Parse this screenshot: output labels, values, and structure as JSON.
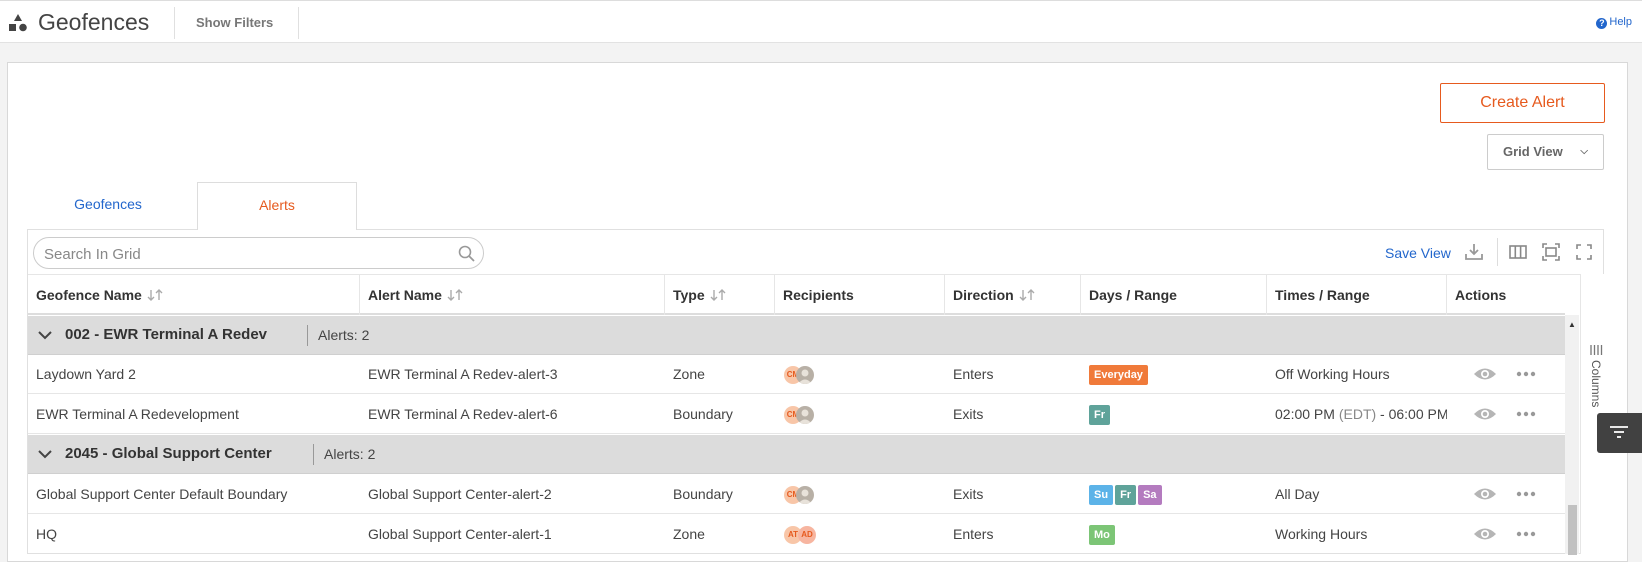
{
  "header": {
    "title": "Geofences",
    "show_filters": "Show Filters",
    "help": "Help"
  },
  "actions": {
    "create_alert": "Create Alert",
    "grid_view": "Grid View"
  },
  "tabs": [
    {
      "label": "Geofences",
      "active": false
    },
    {
      "label": "Alerts",
      "active": true
    }
  ],
  "toolbar": {
    "search_placeholder": "Search In Grid",
    "save_view": "Save View"
  },
  "columns": {
    "geofence_name": "Geofence Name",
    "alert_name": "Alert Name",
    "type": "Type",
    "recipients": "Recipients",
    "direction": "Direction",
    "days_range": "Days / Range",
    "times_range": "Times / Range",
    "actions": "Actions"
  },
  "side_panel": {
    "columns_label": "Columns"
  },
  "groups": [
    {
      "name": "002 - EWR Terminal A Redev",
      "count": "Alerts: 2",
      "rows": [
        {
          "geofence": "Laydown Yard 2",
          "alert": "EWR Terminal A Redev-alert-3",
          "type": "Zone",
          "recipients": [
            "CM",
            "photo"
          ],
          "direction": "Enters",
          "days": [
            {
              "label": "Everyday",
              "color": "#f07a3a"
            }
          ],
          "time_main": "Off Working Hours",
          "time_tz": "",
          "time_end": ""
        },
        {
          "geofence": "EWR Terminal A Redevelopment",
          "alert": "EWR Terminal A Redev-alert-6",
          "type": "Boundary",
          "recipients": [
            "CM",
            "photo"
          ],
          "direction": "Exits",
          "days": [
            {
              "label": "Fr",
              "color": "#5fa39a"
            }
          ],
          "time_main": "02:00 PM ",
          "time_tz": "(EDT)",
          "time_end": " - 06:00 PM"
        }
      ]
    },
    {
      "name": "2045 - Global Support Center",
      "count": "Alerts: 2",
      "rows": [
        {
          "geofence": "Global Support Center Default Boundary",
          "alert": "Global Support Center-alert-2",
          "type": "Boundary",
          "recipients": [
            "CM",
            "photo"
          ],
          "direction": "Exits",
          "days": [
            {
              "label": "Su",
              "color": "#5cb3e8"
            },
            {
              "label": "Fr",
              "color": "#5fa39a"
            },
            {
              "label": "Sa",
              "color": "#b47bbf"
            }
          ],
          "time_main": "All Day",
          "time_tz": "",
          "time_end": ""
        },
        {
          "geofence": "HQ",
          "alert": "Global Support Center-alert-1",
          "type": "Zone",
          "recipients": [
            "AT",
            "AD"
          ],
          "direction": "Enters",
          "days": [
            {
              "label": "Mo",
              "color": "#7cc576"
            }
          ],
          "time_main": "Working Hours",
          "time_tz": "",
          "time_end": ""
        }
      ]
    }
  ]
}
